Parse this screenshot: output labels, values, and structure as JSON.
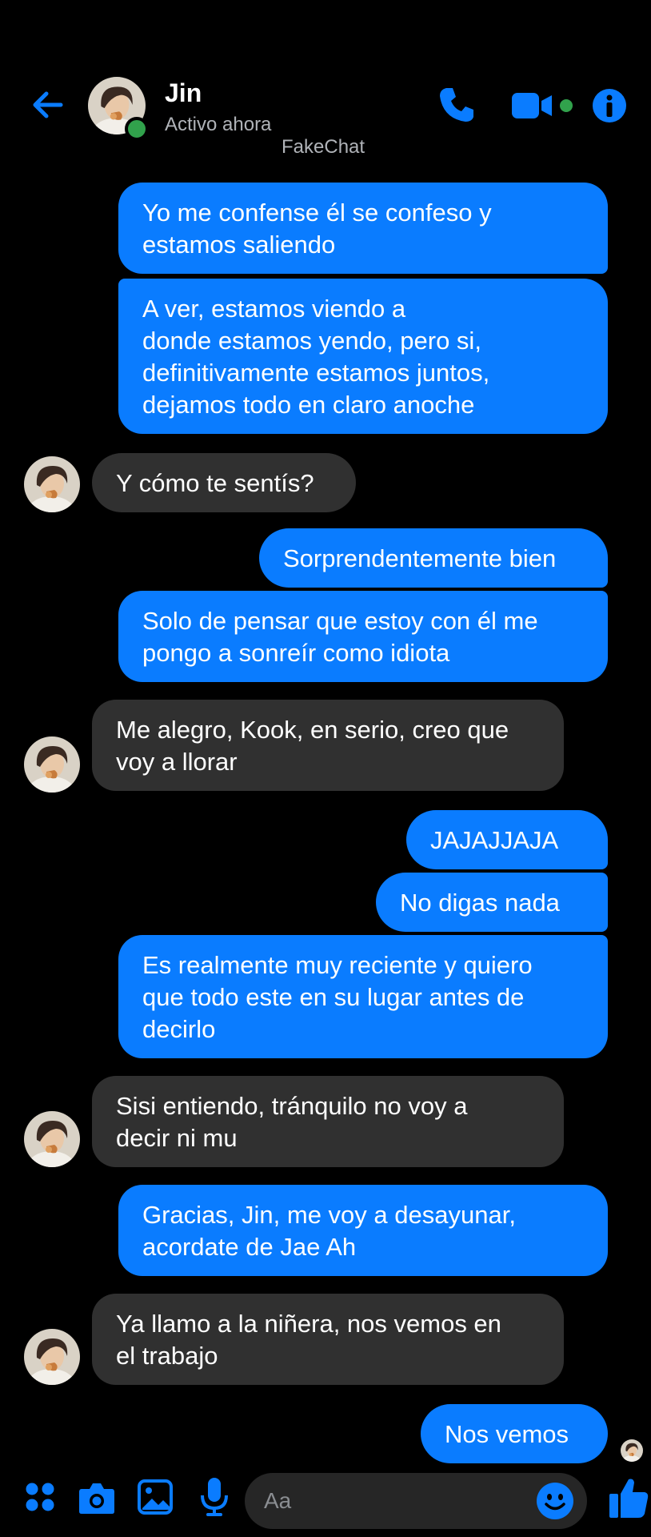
{
  "header": {
    "title": "Jin",
    "status": "Activo ahora",
    "watermark": "FakeChat"
  },
  "colors": {
    "accent": "#0a7cff",
    "outgoing_bubble": "#0a7cff",
    "incoming_bubble": "#303030",
    "online": "#31a24c"
  },
  "icons": [
    "back-arrow-icon",
    "phone-icon",
    "video-icon",
    "info-icon",
    "apps-icon",
    "camera-icon",
    "gallery-icon",
    "microphone-icon",
    "emoji-icon",
    "like-icon"
  ],
  "messages": [
    {
      "from": "me",
      "text": "Yo me confense él se confeso y\nestamos saliendo"
    },
    {
      "from": "me",
      "text": "A ver, estamos viendo a\ndonde estamos yendo, pero si,\ndefinitivamente estamos juntos,\ndejamos todo en claro anoche"
    },
    {
      "from": "Jin",
      "text": "Y cómo te sentís?"
    },
    {
      "from": "me",
      "text": "Sorprendentemente bien"
    },
    {
      "from": "me",
      "text": "Solo de pensar que estoy con él me\npongo a sonreír como idiota"
    },
    {
      "from": "Jin",
      "text": "Me alegro, Kook, en serio, creo que\nvoy a llorar"
    },
    {
      "from": "me",
      "text": "JAJAJJAJA"
    },
    {
      "from": "me",
      "text": "No digas nada"
    },
    {
      "from": "me",
      "text": "Es realmente muy reciente y quiero\nque todo este en su lugar antes de\ndecirlo"
    },
    {
      "from": "Jin",
      "text": "Sisi entiendo, tránquilo no voy a\ndecir ni mu"
    },
    {
      "from": "me",
      "text": "Gracias, Jin, me voy a desayunar,\nacordate de Jae Ah"
    },
    {
      "from": "Jin",
      "text": "Ya llamo a la niñera, nos vemos en\nel trabajo"
    },
    {
      "from": "me",
      "text": "Nos vemos"
    }
  ],
  "composer": {
    "placeholder": "Aa"
  }
}
